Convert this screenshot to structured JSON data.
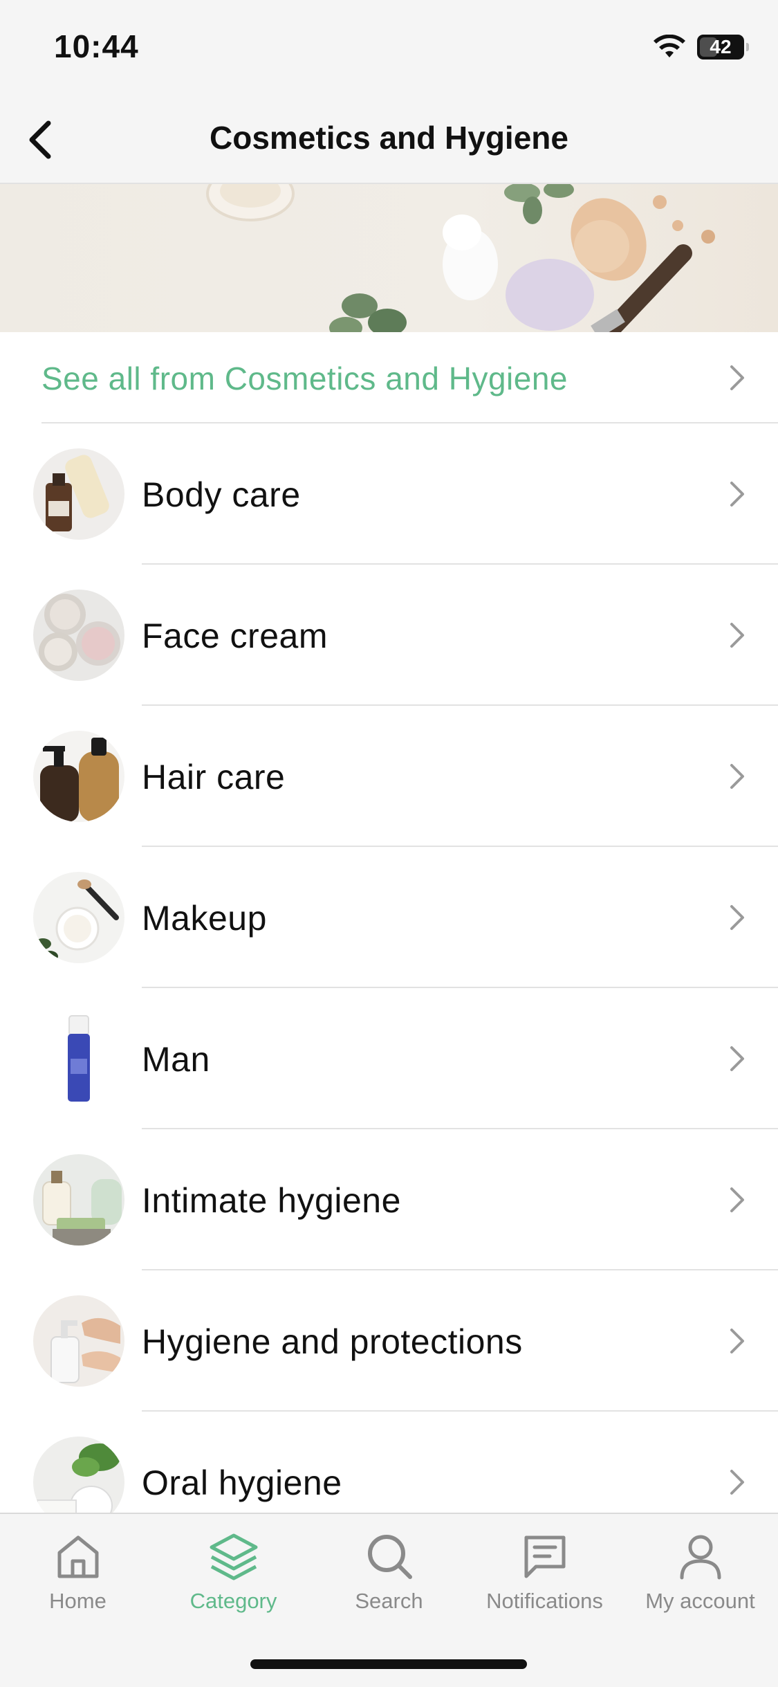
{
  "status_bar": {
    "time": "10:44",
    "battery": "42",
    "battery_level": 0.42
  },
  "nav": {
    "title": "Cosmetics and Hygiene",
    "back_icon": "chevron-left-icon"
  },
  "see_all": {
    "label": "See all from Cosmetics and Hygiene"
  },
  "categories": [
    {
      "label": "Body care",
      "icon": "body-care-thumbnail"
    },
    {
      "label": "Face cream",
      "icon": "face-cream-thumbnail"
    },
    {
      "label": "Hair care",
      "icon": "hair-care-thumbnail"
    },
    {
      "label": "Makeup",
      "icon": "makeup-thumbnail"
    },
    {
      "label": "Man",
      "icon": "man-thumbnail"
    },
    {
      "label": "Intimate hygiene",
      "icon": "intimate-hygiene-thumbnail"
    },
    {
      "label": "Hygiene and protections",
      "icon": "hygiene-protections-thumbnail"
    },
    {
      "label": "Oral hygiene",
      "icon": "oral-hygiene-thumbnail"
    }
  ],
  "tab_bar": {
    "tabs": [
      {
        "label": "Home",
        "icon": "home-icon",
        "active": false
      },
      {
        "label": "Category",
        "icon": "layers-icon",
        "active": true
      },
      {
        "label": "Search",
        "icon": "search-icon",
        "active": false
      },
      {
        "label": "Notifications",
        "icon": "message-icon",
        "active": false
      },
      {
        "label": "My account",
        "icon": "user-icon",
        "active": false
      }
    ]
  },
  "colors": {
    "accent": "#5fb98a",
    "inactive": "#8a8a8a",
    "background_bar": "#f5f5f5"
  }
}
